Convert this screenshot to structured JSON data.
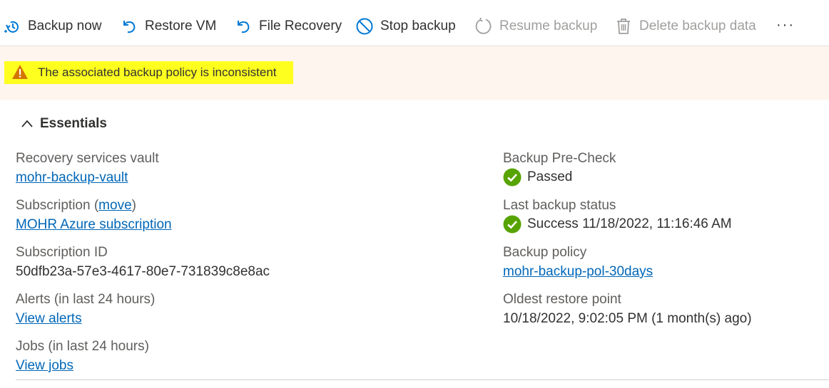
{
  "toolbar": {
    "backup_now": "Backup now",
    "restore_vm": "Restore VM",
    "file_recovery": "File Recovery",
    "stop_backup": "Stop backup",
    "resume_backup": "Resume backup",
    "delete_backup_data": "Delete backup data",
    "more": "···"
  },
  "banner": {
    "text": "The associated backup policy is inconsistent",
    "icon": "warning-icon",
    "highlight_color": "#ffff1f",
    "background": "#fdf5ee"
  },
  "essentials": {
    "title": "Essentials",
    "left": {
      "vault_label": "Recovery services vault",
      "vault_value": "mohr-backup-vault",
      "subscription_label": "Subscription",
      "subscription_open": "(",
      "subscription_move": "move",
      "subscription_close": ")",
      "subscription_value": "MOHR Azure subscription",
      "subscription_id_label": "Subscription ID",
      "subscription_id_value": "50dfb23a-57e3-4617-80e7-731839c8e8ac",
      "alerts_label": "Alerts (in last 24 hours)",
      "alerts_value": "View alerts",
      "jobs_label": "Jobs (in last 24 hours)",
      "jobs_value": "View jobs"
    },
    "right": {
      "precheck_label": "Backup Pre-Check",
      "precheck_value": "Passed",
      "last_status_label": "Last backup status",
      "last_status_value": "Success 11/18/2022, 11:16:46 AM",
      "policy_label": "Backup policy",
      "policy_value": "mohr-backup-pol-30days",
      "oldest_label": "Oldest restore point",
      "oldest_value": "10/18/2022, 9:02:05 PM (1 month(s) ago)"
    }
  },
  "colors": {
    "link": "#0067b8",
    "success": "#57a300",
    "warning": "#d47500",
    "disabled": "#a19f9d"
  }
}
